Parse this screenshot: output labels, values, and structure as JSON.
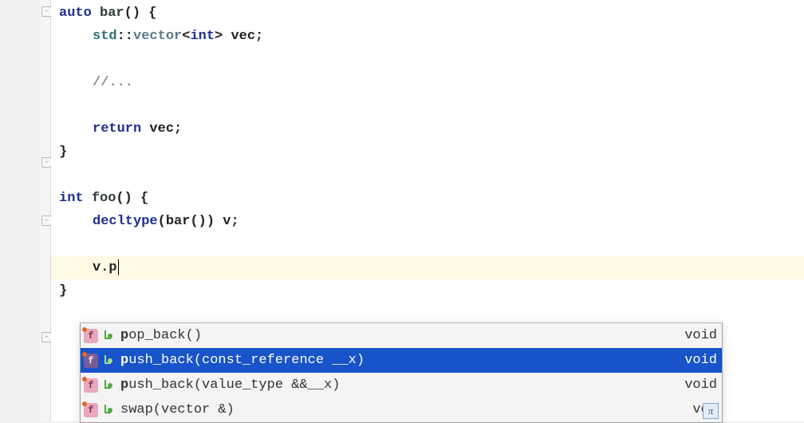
{
  "code": {
    "l1_kw": "auto",
    "l1_fn": "bar",
    "l1_tail": "() {",
    "l2_ns": "std",
    "l2_dcolon": "::",
    "l2_vec": "vector",
    "l2_gen": "<",
    "l2_int": "int",
    "l2_close": "> vec;",
    "l4_comment": "//...",
    "l6_return": "return",
    "l6_tail": " vec;",
    "l7_close": "}",
    "l9_kw": "int",
    "l9_fn": "foo",
    "l9_tail": "() {",
    "l10_dt": "decltype",
    "l10_tail": "(bar()) v;",
    "l12_text": "v.p",
    "l13_close": "}"
  },
  "completion": {
    "items": [
      {
        "prefix": "p",
        "rest": "op_back()",
        "ret": "void",
        "selected": false
      },
      {
        "prefix": "p",
        "rest": "ush_back(const_reference __x)",
        "ret": "void",
        "selected": true
      },
      {
        "prefix": "p",
        "rest": "ush_back(value_type &&__x)",
        "ret": "void",
        "selected": false
      },
      {
        "prefix": "",
        "rest": "swap(vector &)",
        "ret": "voi",
        "selected": false
      }
    ]
  }
}
